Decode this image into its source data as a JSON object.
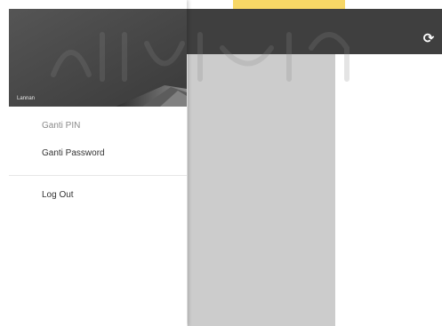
{
  "toolbar": {
    "refresh_icon": "refresh-icon",
    "refresh_glyph": "⟳"
  },
  "drawer": {
    "header_username": "Lannan",
    "items": [
      {
        "label": "Ganti PIN"
      },
      {
        "label": "Ganti Password"
      },
      {
        "label": "Log Out"
      }
    ]
  },
  "colors": {
    "topbar": "#3f3f3f",
    "panel": "#cccccc",
    "drawer_header": "#4a4a4a",
    "accent_yellow": "#f7d766"
  }
}
